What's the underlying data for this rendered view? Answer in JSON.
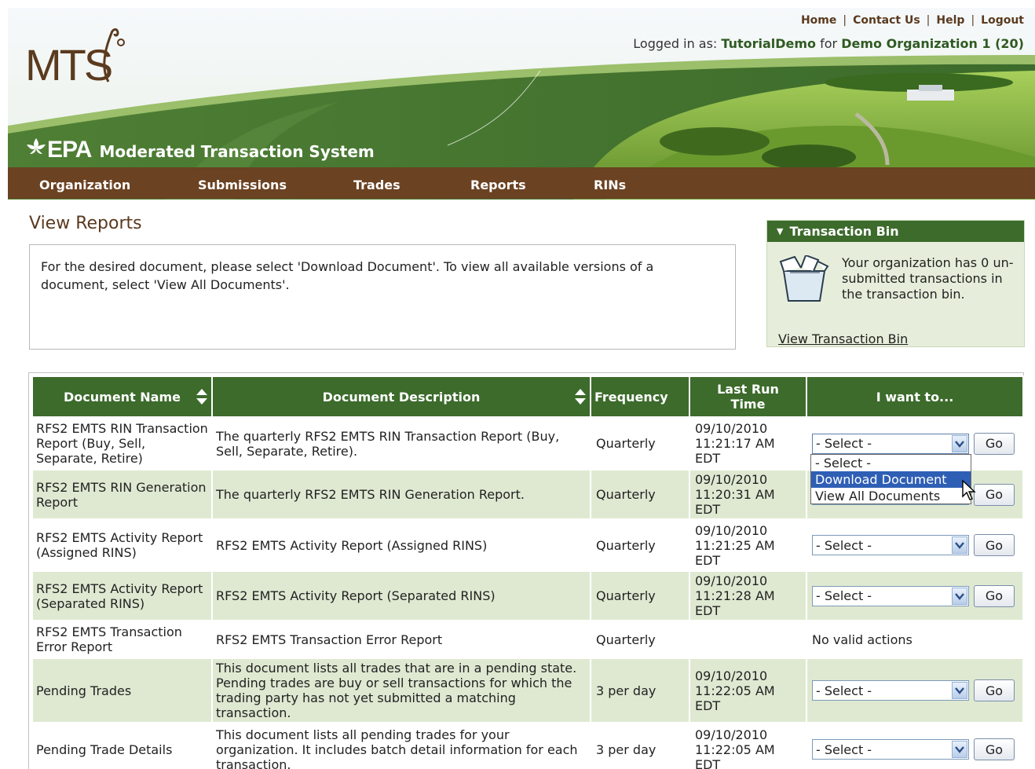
{
  "header": {
    "links": [
      "Home",
      "Contact Us",
      "Help",
      "Logout"
    ],
    "logged_in_prefix": "Logged in as: ",
    "user": "TutorialDemo",
    "for_word": " for ",
    "organization": "Demo Organization 1 (20)",
    "logo_text": "MTS",
    "epa_text": "EPA",
    "system_title": "Moderated Transaction System"
  },
  "nav": {
    "items": [
      "Organization",
      "Submissions",
      "Trades",
      "Reports",
      "RINs"
    ]
  },
  "page": {
    "title": "View Reports",
    "instructions": "For the desired document, please select 'Download Document'. To view all available versions of a document, select 'View All Documents'."
  },
  "bin": {
    "title": "Transaction Bin",
    "message": "Your organization has 0 un-submitted transactions in the transaction bin.",
    "link": "View Transaction Bin"
  },
  "table": {
    "headers": [
      "Document Name",
      "Document Description",
      "Frequency",
      "Last Run Time",
      "I want to..."
    ],
    "rows": [
      {
        "name": "RFS2 EMTS RIN Transaction Report (Buy, Sell, Separate, Retire)",
        "desc": "The quarterly RFS2 EMTS RIN Transaction Report (Buy, Sell, Separate, Retire).",
        "freq": "Quarterly",
        "date": "09/10/2010",
        "time": "11:21:17 AM",
        "tz": "EDT",
        "action": "- Select -",
        "go": "Go"
      },
      {
        "name": "RFS2 EMTS RIN Generation Report",
        "desc": "The quarterly RFS2 EMTS RIN Generation Report.",
        "freq": "Quarterly",
        "date": "09/10/2010",
        "time": "11:20:31 AM",
        "tz": "EDT",
        "action": "- Select -",
        "go": "Go"
      },
      {
        "name": "RFS2 EMTS Activity Report (Assigned RINS)",
        "desc": "RFS2 EMTS Activity Report (Assigned RINS)",
        "freq": "Quarterly",
        "date": "09/10/2010",
        "time": "11:21:25 AM",
        "tz": "EDT",
        "action": "- Select -",
        "go": "Go"
      },
      {
        "name": "RFS2 EMTS Activity Report (Separated RINS)",
        "desc": "RFS2 EMTS Activity Report (Separated RINS)",
        "freq": "Quarterly",
        "date": "09/10/2010",
        "time": "11:21:28 AM",
        "tz": "EDT",
        "action": "- Select -",
        "go": "Go"
      },
      {
        "name": "RFS2 EMTS Transaction Error Report",
        "desc": "RFS2 EMTS Transaction Error Report",
        "freq": "Quarterly",
        "date": "",
        "time": "",
        "tz": "",
        "action": "No valid actions",
        "go": ""
      },
      {
        "name": "Pending Trades",
        "desc": "This document lists all trades that are in a pending state. Pending trades are buy or sell transactions for which the trading party has not yet submitted a matching transaction.",
        "freq": "3 per day",
        "date": "09/10/2010",
        "time": "11:22:05 AM",
        "tz": "EDT",
        "action": "- Select -",
        "go": "Go"
      },
      {
        "name": "Pending Trade Details",
        "desc": "This document lists all pending trades for your organization. It includes batch detail information for each transaction.",
        "freq": "3 per day",
        "date": "09/10/2010",
        "time": "11:22:05 AM",
        "tz": "EDT",
        "action": "- Select -",
        "go": "Go"
      }
    ]
  },
  "dropdown": {
    "options": [
      "- Select -",
      "Download Document",
      "View All Documents"
    ],
    "highlighted": "Download Document"
  },
  "colors": {
    "nav_brown": "#6b4222",
    "header_green": "#3c6b2b",
    "row_green": "#dfe9d2",
    "highlight_blue": "#2f5fb5"
  }
}
